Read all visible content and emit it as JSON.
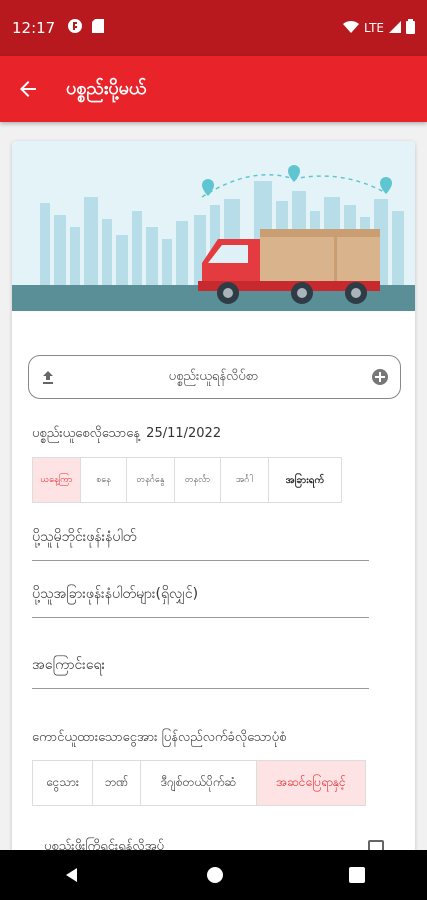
{
  "status_bar": {
    "time": "12:17",
    "network": "LTE"
  },
  "app_bar": {
    "title": "ပစ္စည်းပို့မယ်"
  },
  "upload": {
    "label": "ပစ္စည်းယူရန်လိပ်စာ"
  },
  "pickup_date": {
    "label": "ပစ္စည်းယူစေလိုသောနေ့",
    "value": "25/11/2022"
  },
  "day_options": [
    {
      "label": "ယနေ့ကြာ",
      "selected": true
    },
    {
      "label": "စနေ",
      "selected": false
    },
    {
      "label": "တနင်္ဂနွေ",
      "selected": false
    },
    {
      "label": "တနင်္လာ",
      "selected": false
    },
    {
      "label": "အင်္ဂါ",
      "selected": false
    },
    {
      "label": "အခြားရက်",
      "selected": false
    }
  ],
  "fields": {
    "sender_phone": "ပို့သူမိုဘိုင်းဖုန်းနံပါတ်",
    "other_phones": "ပို့သူအခြားဖုန်းနံပါတ်များ(ရှိလျှင်)",
    "note": "အကြောင်းရေး"
  },
  "refund": {
    "title": "ကောင်ယူထားသောငွေအား ပြန်လည်လက်ခံလိုသောပုံစံ",
    "options": [
      {
        "label": "ငွေသား",
        "selected": false
      },
      {
        "label": "ဘဏ်",
        "selected": false
      },
      {
        "label": "ဒီဂျစ်တယ်ပိုက်ဆံ",
        "selected": false
      },
      {
        "label": "အဆင်ပြေရာနှင့်",
        "selected": true
      }
    ]
  },
  "last_option": {
    "label": "ပစ္စည်းဖိုးကြိုရင်းရန်လိုအပ်"
  },
  "colors": {
    "status_bar": "#b7191f",
    "app_bar": "#e8232a",
    "accent": "#e8232a",
    "chip_selected_bg": "#fde3e4"
  }
}
